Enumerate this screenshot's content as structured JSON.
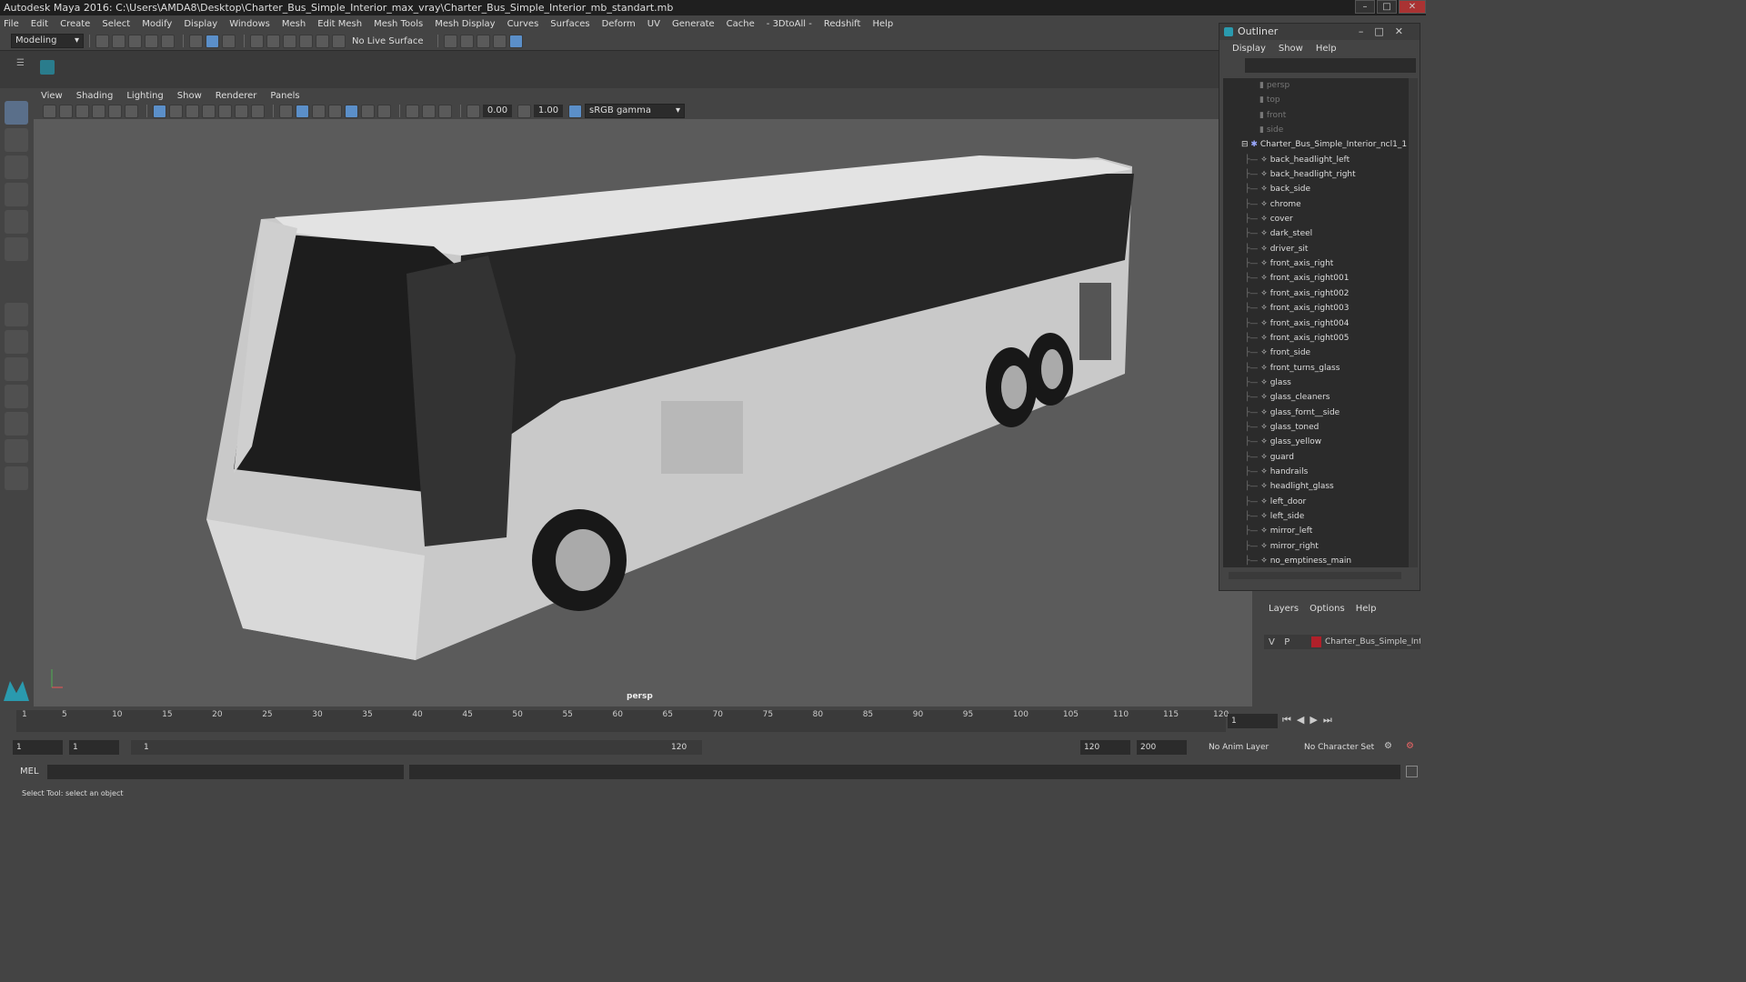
{
  "window": {
    "title": "Autodesk Maya 2016: C:\\Users\\AMDA8\\Desktop\\Charter_Bus_Simple_Interior_max_vray\\Charter_Bus_Simple_Interior_mb_standart.mb"
  },
  "menubar": {
    "items": [
      "File",
      "Edit",
      "Create",
      "Select",
      "Modify",
      "Display",
      "Windows",
      "Mesh",
      "Edit Mesh",
      "Mesh Tools",
      "Mesh Display",
      "Curves",
      "Surfaces",
      "Deform",
      "UV",
      "Generate",
      "Cache",
      "- 3DtoAll -",
      "Redshift",
      "Help"
    ]
  },
  "statusline": {
    "mode": "Modeling",
    "live_surface": "No Live Surface"
  },
  "viewport": {
    "menu": [
      "View",
      "Shading",
      "Lighting",
      "Show",
      "Renderer",
      "Panels"
    ],
    "exposure": "0.00",
    "gamma": "1.00",
    "colorspace": "sRGB gamma",
    "camera_label": "persp"
  },
  "outliner": {
    "title": "Outliner",
    "menu": [
      "Display",
      "Show",
      "Help"
    ],
    "cameras": [
      "persp",
      "top",
      "front",
      "side"
    ],
    "group": "Charter_Bus_Simple_Interior_ncl1_1",
    "children": [
      "back_headlight_left",
      "back_headlight_right",
      "back_side",
      "chrome",
      "cover",
      "dark_steel",
      "driver_sit",
      "front_axis_right",
      "front_axis_right001",
      "front_axis_right002",
      "front_axis_right003",
      "front_axis_right004",
      "front_axis_right005",
      "front_side",
      "front_turns_glass",
      "glass",
      "glass_cleaners",
      "glass_fornt__side",
      "glass_toned",
      "glass_yellow",
      "guard",
      "handrails",
      "headlight_glass",
      "left_door",
      "left_side",
      "mirror_left",
      "mirror_right",
      "no_emptiness_main"
    ]
  },
  "layers": {
    "menu": [
      "Layers",
      "Options",
      "Help"
    ],
    "row": {
      "v": "V",
      "p": "P",
      "name": "Charter_Bus_Simple_Inte",
      "color": "#b0202a"
    }
  },
  "timeline": {
    "ticks": [
      "1",
      "5",
      "10",
      "15",
      "20",
      "25",
      "30",
      "35",
      "40",
      "45",
      "50",
      "55",
      "60",
      "65",
      "70",
      "75",
      "80",
      "85",
      "90",
      "95",
      "100",
      "105",
      "110",
      "115",
      "120"
    ],
    "current_frame": "1"
  },
  "range": {
    "start": "1",
    "inner_start": "1",
    "slider_start": "1",
    "slider_end": "120",
    "end": "120",
    "max": "200",
    "anim_layer": "No Anim Layer",
    "char_set": "No Character Set"
  },
  "cmd": {
    "label": "MEL"
  },
  "help": {
    "text": "Select Tool: select an object"
  }
}
